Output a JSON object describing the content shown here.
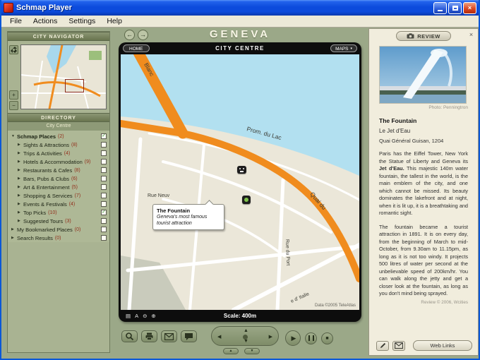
{
  "glyphs": {
    "close": "×",
    "back": "←",
    "forward": "→",
    "tri_open": "▼",
    "tri_closed": "▶",
    "chevron_down": "▾",
    "dpad_left": "◀",
    "dpad_right": "▶",
    "dpad_up": "▲",
    "dpad_down": "▼",
    "play": "▶",
    "stop": "■",
    "plus": "+",
    "minus": "−",
    "zoom_in": "▲",
    "zoom_out": "▼",
    "legend": "▤",
    "font": "A",
    "circle_minus": "⊖",
    "circle_plus": "⊕"
  },
  "colors": {
    "titlebar_blue": "#0a57d8",
    "sage_background": "#9ba888",
    "map_orange": "#f08c1e",
    "water_blue": "#b2e0f0",
    "panel_cream": "#f1eddd"
  },
  "window": {
    "title": "Schmap Player",
    "menu_items": [
      "File",
      "Actions",
      "Settings",
      "Help"
    ]
  },
  "navigator": {
    "title": "CITY NAVIGATOR"
  },
  "directory": {
    "title": "DIRECTORY",
    "subtitle": "City Centre",
    "items": [
      {
        "label": "Schmap Places",
        "count": "(2)",
        "check": "✓"
      },
      {
        "label": "Sights & Attractions",
        "count": "(8)",
        "check": ""
      },
      {
        "label": "Trips & Activities",
        "count": "(4)",
        "check": ""
      },
      {
        "label": "Hotels & Accommodation",
        "count": "(9)",
        "check": ""
      },
      {
        "label": "Restaurants & Cafes",
        "count": "(8)",
        "check": ""
      },
      {
        "label": "Bars, Pubs & Clubs",
        "count": "(6)",
        "check": ""
      },
      {
        "label": "Art & Entertainment",
        "count": "(5)",
        "check": ""
      },
      {
        "label": "Shopping & Services",
        "count": "(7)",
        "check": ""
      },
      {
        "label": "Events & Festivals",
        "count": "(4)",
        "check": ""
      },
      {
        "label": "Top Picks",
        "count": "(10)",
        "check": "✓"
      },
      {
        "label": "Suggested Tours",
        "count": "(3)",
        "check": ""
      },
      {
        "label": "My Bookmarked Places",
        "count": "(0)",
        "check": ""
      },
      {
        "label": "Search Results",
        "count": "(0)",
        "check": ""
      }
    ]
  },
  "map": {
    "city_title": "GENEVA",
    "home_label": "HOME",
    "panel_title": "CITY CENTRE",
    "maps_label": "MAPS",
    "scale_label": "Scale: 400m",
    "copyright": "Data ©2005 TeleAtlas",
    "callout": {
      "title": "The Fountain",
      "text": "Geneva's most famous tourist attraction"
    },
    "streets": {
      "blanc": "Blanc",
      "prom_du_lac": "Prom. du Lac",
      "quai": "Quai du",
      "rue_neuve": "Rue Neuv",
      "rue_du_port": "Rue du Port",
      "italie": "e d' Italie"
    }
  },
  "review": {
    "tab_label": "REVIEW",
    "photo_credit": "Photo: Penningtron",
    "title": "The Fountain",
    "subtitle": "Le Jet d'Eau",
    "address": "Quai Général Guisan, 1204",
    "p1a": "Paris has the Eiffel Tower, New York the Statue of Liberty and Geneva its ",
    "p1b": "Jet d'Eau.",
    "p1c": " This majestic 140m water fountain, the tallest in the world, is the main emblem of the city, and one which cannot be missed. Its beauty dominates the lakefront and at night, when it is lit up, it is a breathtaking and romantic sight.",
    "p2": "The fountain became a tourist attraction in 1891. It is on every day, from the beginning of March to mid-October, from 9.30am to 11.15pm, as long as it is not too windy. It projects 500 litres of water per second at the unbelievable speed of 200km/hr. You can walk along the jetty and get a closer look at the fountain, as long as you don't mind being sprayed.",
    "credit": "Review © 2006, Wcities",
    "web_links_label": "Web Links"
  }
}
